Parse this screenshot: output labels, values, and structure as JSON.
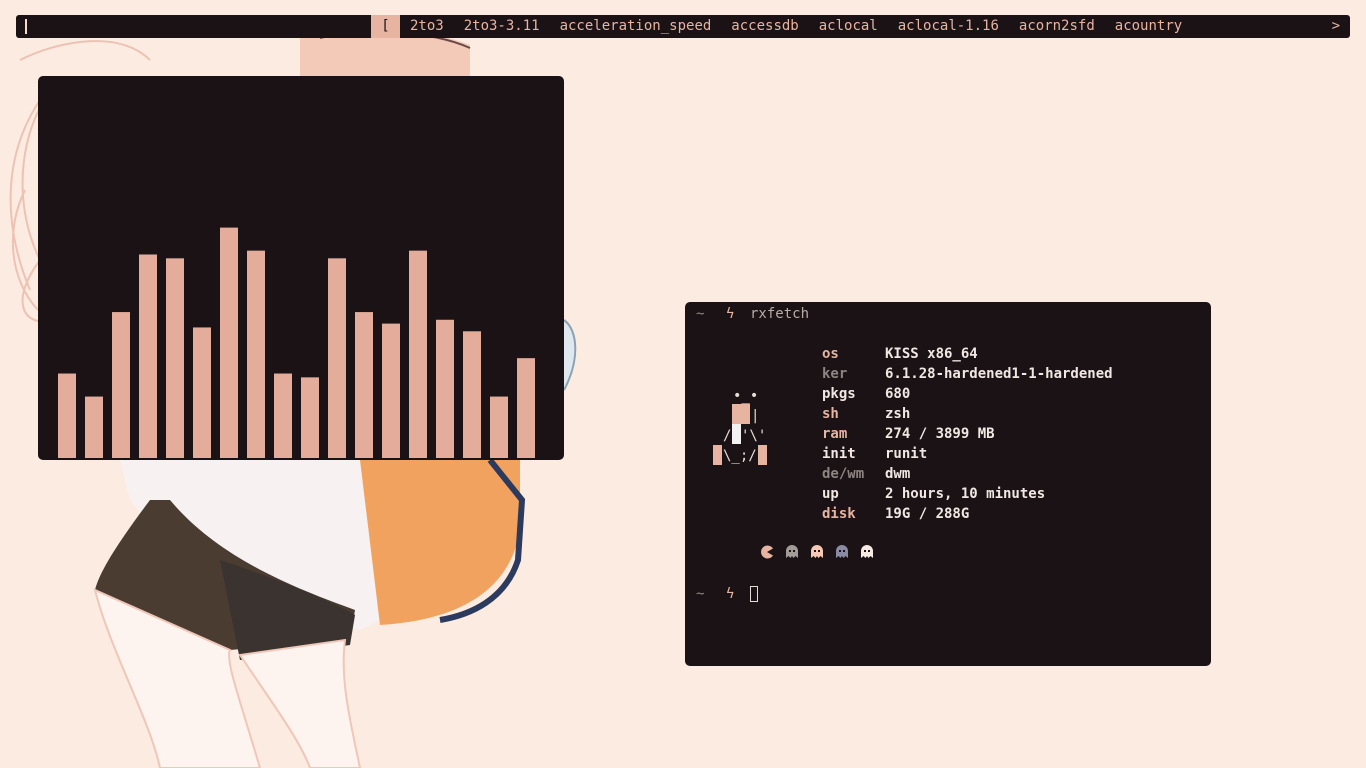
{
  "dmenu": {
    "open_bracket": "[",
    "items": [
      "2to3",
      "2to3-3.11",
      "acceleration_speed",
      "accessdb",
      "aclocal",
      "aclocal-1.16",
      "acorn2sfd",
      "acountry"
    ],
    "more": ">"
  },
  "visualizer": {
    "bar_color": "#e4ad9b",
    "levels": [
      0.22,
      0.16,
      0.38,
      0.53,
      0.52,
      0.34,
      0.6,
      0.54,
      0.22,
      0.21,
      0.52,
      0.38,
      0.35,
      0.54,
      0.36,
      0.33,
      0.16,
      0.26
    ]
  },
  "terminal": {
    "prompt_tilde": "~",
    "prompt_symbol": "ϟ",
    "command": "rxfetch",
    "info": [
      {
        "key": "os",
        "value": "KISS x86_64"
      },
      {
        "key": "ker",
        "value": "6.1.28-hardened1-1-hardened"
      },
      {
        "key": "pkgs",
        "value": "680"
      },
      {
        "key": "sh",
        "value": "zsh"
      },
      {
        "key": "ram",
        "value": "274 / 3899 MB"
      },
      {
        "key": "init",
        "value": "runit"
      },
      {
        "key": "de/wm",
        "value": "dwm"
      },
      {
        "key": "up",
        "value": "2 hours, 10 minutes"
      },
      {
        "key": "disk",
        "value": "19G / 288G"
      }
    ],
    "pacman_colors": [
      "#e8b4a2",
      "#a39b98",
      "#f5c9b5",
      "#8b8aa3",
      "#f7eae3"
    ]
  },
  "colors": {
    "background": "#fcebe1",
    "window": "#1a1215",
    "accent": "#e8b4a2"
  }
}
